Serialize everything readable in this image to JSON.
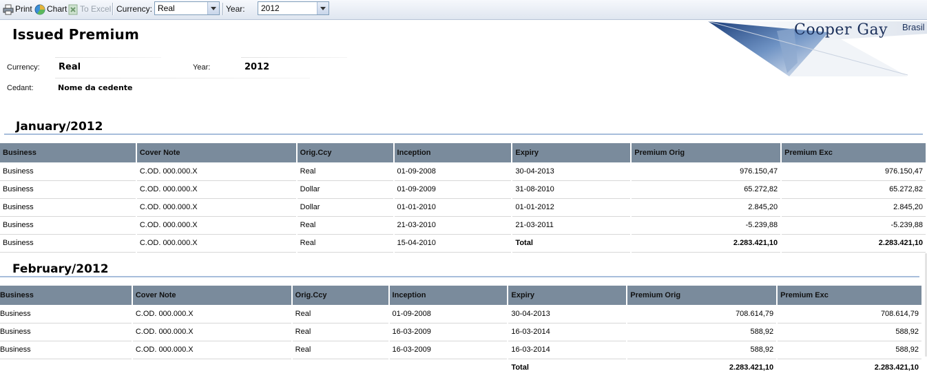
{
  "toolbar": {
    "print_label": "Print",
    "chart_label": "Chart",
    "excel_label": "To Excel",
    "currency_label": "Currency:",
    "currency_value": "Real",
    "year_label": "Year:",
    "year_value": "2012"
  },
  "report": {
    "title": "Issued Premium",
    "currency_label": "Currency:",
    "currency_value": "Real",
    "year_label": "Year:",
    "year_value": "2012",
    "cedant_label": "Cedant:",
    "cedant_value": "Nome da cedente"
  },
  "logo": {
    "name": "Cooper Gay",
    "suffix": "Brasil"
  },
  "columns": [
    "Business",
    "Cover Note",
    "Orig.Ccy",
    "Inception",
    "Expiry",
    "Premium Orig",
    "Premium Exc"
  ],
  "january": {
    "title": "January/2012",
    "rows": [
      [
        "Business",
        "C.OD. 000.000.X",
        "Real",
        "01-09-2008",
        "30-04-2013",
        "976.150,47",
        "976.150,47"
      ],
      [
        "Business",
        "C.OD. 000.000.X",
        "Dollar",
        "01-09-2009",
        "31-08-2010",
        "65.272,82",
        "65.272,82"
      ],
      [
        "Business",
        "C.OD. 000.000.X",
        "Dollar",
        "01-01-2010",
        "01-01-2012",
        "2.845,20",
        "2.845,20"
      ],
      [
        "Business",
        "C.OD. 000.000.X",
        "Real",
        "21-03-2010",
        "21-03-2011",
        "-5.239,88",
        "-5.239,88"
      ],
      [
        "Business",
        "C.OD. 000.000.X",
        "Real",
        "15-04-2010",
        "Total",
        "2.283.421,10",
        "2.283.421,10"
      ]
    ]
  },
  "february": {
    "title": "February/2012",
    "rows": [
      [
        "Business",
        "C.OD. 000.000.X",
        "Real",
        "01-09-2008",
        "30-04-2013",
        "708.614,79",
        "708.614,79"
      ],
      [
        "Business",
        "C.OD. 000.000.X",
        "Real",
        "16-03-2009",
        "16-03-2014",
        "588,92",
        "588,92"
      ],
      [
        "Business",
        "C.OD. 000.000.X",
        "Real",
        "16-03-2009",
        "16-03-2014",
        "588,92",
        "588,92"
      ]
    ],
    "total_label": "Total",
    "total_orig": "2.283.421,10",
    "total_exc": "2.283.421,10"
  }
}
